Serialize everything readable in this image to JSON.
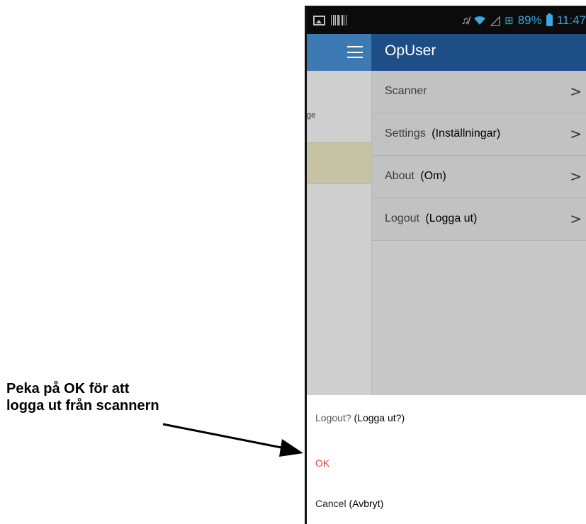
{
  "annotation": {
    "line1": "Peka på OK för att",
    "line2": "logga ut från scannern"
  },
  "status_bar": {
    "battery_percent": "89%",
    "time": "11:47",
    "icons": [
      "image-icon",
      "barcode-icon",
      "mute-icon",
      "wifi-icon",
      "signal-icon",
      "network-icon",
      "battery-icon"
    ]
  },
  "app_bar": {
    "title": "OpUser",
    "menu_icon": "hamburger-menu-icon",
    "accent_color": "#1d4f86"
  },
  "background": {
    "partial_text": "ge"
  },
  "drawer": {
    "items": [
      {
        "label": "Scanner",
        "note": ""
      },
      {
        "label": "Settings",
        "note": "(Inställningar)"
      },
      {
        "label": "About",
        "note": "(Om)"
      },
      {
        "label": "Logout",
        "note": "(Logga ut)"
      }
    ],
    "chevron": ">"
  },
  "dialog": {
    "title": "Logout?",
    "title_note": "(Logga ut?)",
    "ok_label": "OK",
    "cancel_label": "Cancel",
    "cancel_note": "(Avbryt)",
    "ok_color": "#e0433a"
  }
}
